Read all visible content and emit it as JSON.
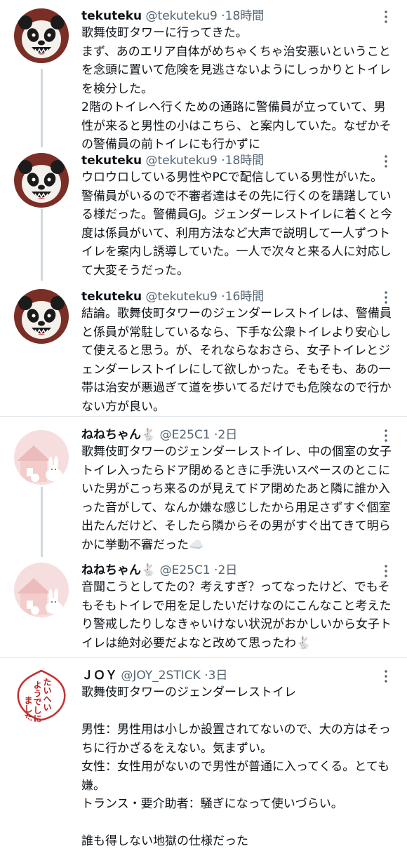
{
  "tweets": [
    {
      "name": "tekuteku",
      "handle": "@tekuteku9",
      "time": "18時間",
      "avatar_icon": "panda-avatar-icon",
      "text": "歌舞伎町タワーに行ってきた。\nまず、あのエリア自体がめちゃくちゃ治安悪いということを念頭に置いて危険を見逃さないようにしっかりとトイレを検分した。\n2階のトイレへ行くための通路に警備員が立っていて、男性が来ると男性の小はこちら、と案内していた。なぜかその警備員の前トイレにも行かずに"
    },
    {
      "name": "tekuteku",
      "handle": "@tekuteku9",
      "time": "18時間",
      "avatar_icon": "panda-avatar-icon",
      "text": "ウロウロしている男性やPCで配信している男性がいた。警備員がいるので不審者達はその先に行くのを躊躇している様だった。警備員GJ。ジェンダーレストイレに着くと今度は係員がいて、利用方法など大声で説明して一人ずつトイレを案内し誘導していた。一人で次々と来る人に対応して大変そうだった。"
    },
    {
      "name": "tekuteku",
      "handle": "@tekuteku9",
      "time": "16時間",
      "avatar_icon": "panda-avatar-icon",
      "text": "結論。歌舞伎町タワーのジェンダーレストイレは、警備員と係員が常駐しているなら、下手な公衆トイレより安心して使えると思う。が、それならなおさら、女子トイレとジェンダーレストイレにして欲しかった。そもそも、あの一帯は治安が悪過ぎて道を歩いてるだけでも危険なので行かない方が良い。"
    },
    {
      "name": "ねねちゃん🐇",
      "handle": "@E25C1",
      "time": "2日",
      "avatar_icon": "rabbit-house-avatar-icon",
      "text": "歌舞伎町タワーのジェンダーレストイレ、中の個室の女子トイレ入ったらドア閉めるときに手洗いスペースのとこにいた男がこっち来るのが見えてドア閉めたあと隣に誰か入った音がして、なんか嫌な感じしたから用足さずすぐ個室出たんだけど、そしたら隣からその男がすぐ出てきて明らかに挙動不審だった☁️"
    },
    {
      "name": "ねねちゃん🐇",
      "handle": "@E25C1",
      "time": "2日",
      "avatar_icon": "rabbit-house-avatar-icon",
      "text": "音聞こうとしてたの？考えすぎ？ってなったけど、でもそもそもトイレで用を足したいだけなのにこんなこと考えたり警戒したりしなきゃいけない状況がおかしいから女子トイレは絶対必要だよなと改めて思ったわ🐇"
    },
    {
      "name": "ＪＯＹ",
      "handle": "@JOY_2STICK",
      "time": "3日",
      "avatar_icon": "calligraphy-avatar-icon",
      "avatar_text": "たいへいようでしにました",
      "text": "歌舞伎町タワーのジェンダーレストイレ\n\n男性：男性用は小しか設置されてないので、大の方はそっちに行かざるをえない。気まずい。\n女性：女性用がないので男性が普通に入ってくる。とても嫌。\nトランス・要介助者：騒ぎになって使いづらい。\n\n誰も得しない地獄の仕様だった"
    }
  ]
}
